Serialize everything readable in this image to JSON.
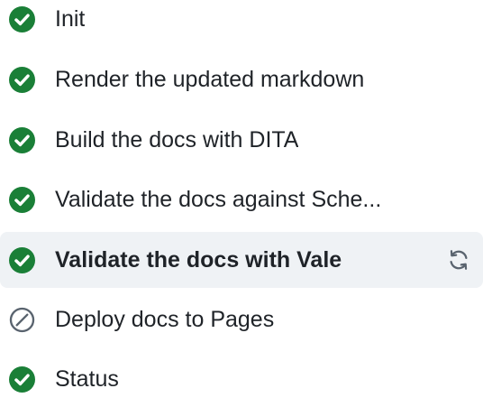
{
  "jobs": [
    {
      "label": "Init",
      "status": "success"
    },
    {
      "label": "Render the updated markdown",
      "status": "success"
    },
    {
      "label": "Build the docs with DITA",
      "status": "success"
    },
    {
      "label": "Validate the docs against Sche...",
      "status": "success"
    },
    {
      "label": "Validate the docs with Vale",
      "status": "success",
      "selected": true
    },
    {
      "label": "Deploy docs to Pages",
      "status": "skipped"
    },
    {
      "label": "Status",
      "status": "success"
    }
  ],
  "icons": {
    "success": "check-circle-fill-icon",
    "skipped": "skip-circle-icon",
    "rerun": "sync-icon"
  },
  "colors": {
    "success": "#1a7f37",
    "skipped": "#59636e",
    "selected_background": "#eff2f5",
    "text": "#1f2328"
  }
}
